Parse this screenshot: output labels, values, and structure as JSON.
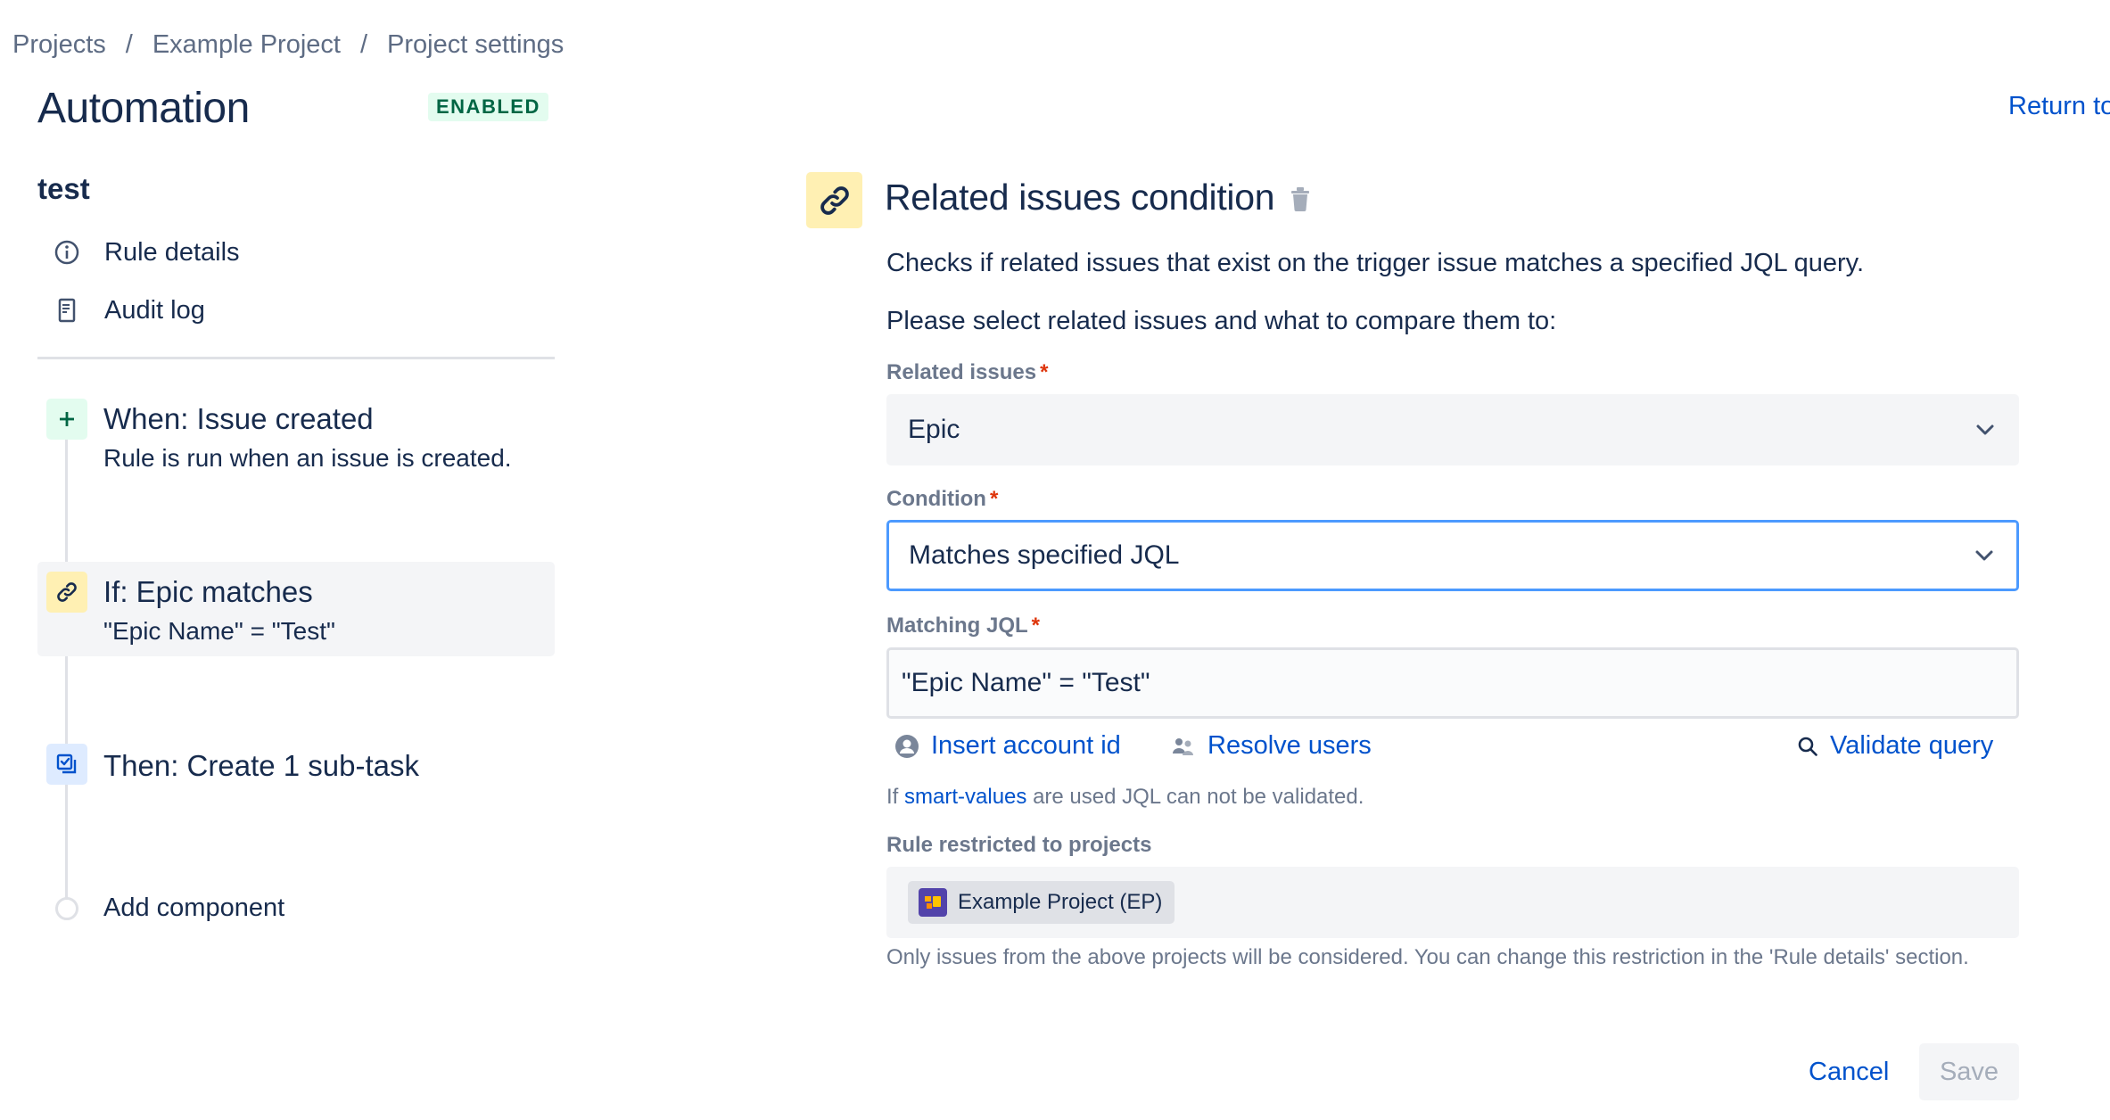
{
  "breadcrumb": {
    "items": [
      "Projects",
      "Example Project",
      "Project settings"
    ],
    "separator": "/"
  },
  "header": {
    "title": "Automation",
    "status_badge": "ENABLED",
    "return_link": "Return to"
  },
  "sidebar": {
    "rule_name": "test",
    "nav": [
      {
        "label": "Rule details",
        "icon": "info-icon"
      },
      {
        "label": "Audit log",
        "icon": "document-icon"
      }
    ],
    "steps": [
      {
        "title": "When: Issue created",
        "subtitle": "Rule is run when an issue is created.",
        "icon": "plus-icon",
        "color": "#e3fcef"
      },
      {
        "title": "If: Epic matches",
        "subtitle": "\"Epic Name\" = \"Test\"",
        "icon": "link-icon",
        "color": "#fff0b3",
        "selected": true
      },
      {
        "title": "Then: Create 1 sub-task",
        "subtitle": "",
        "icon": "subtask-icon",
        "color": "#deebff"
      }
    ],
    "add_component": "Add component"
  },
  "panel": {
    "title": "Related issues condition",
    "description": "Checks if related issues that exist on the trigger issue matches a specified JQL query.",
    "instruction": "Please select related issues and what to compare them to:",
    "related_issues": {
      "label": "Related issues",
      "value": "Epic"
    },
    "condition": {
      "label": "Condition",
      "value": "Matches specified JQL"
    },
    "matching_jql": {
      "label": "Matching JQL",
      "value": "\"Epic Name\" = \"Test\""
    },
    "actions": {
      "insert_account_id": "Insert account id",
      "resolve_users": "Resolve users",
      "validate_query": "Validate query"
    },
    "hint": {
      "prefix": "If",
      "link": "smart-values",
      "suffix": "are used JQL can not be validated."
    },
    "restricted": {
      "label": "Rule restricted to projects",
      "project": "Example Project (EP)"
    },
    "footnote": "Only issues from the above projects will be considered. You can change this restriction in the 'Rule details' section.",
    "buttons": {
      "cancel": "Cancel",
      "save": "Save"
    }
  },
  "colors": {
    "accent": "#0052cc",
    "focus": "#4c9aff",
    "required": "#de350b",
    "enabled_bg": "#e3fcef",
    "enabled_text": "#006644"
  }
}
